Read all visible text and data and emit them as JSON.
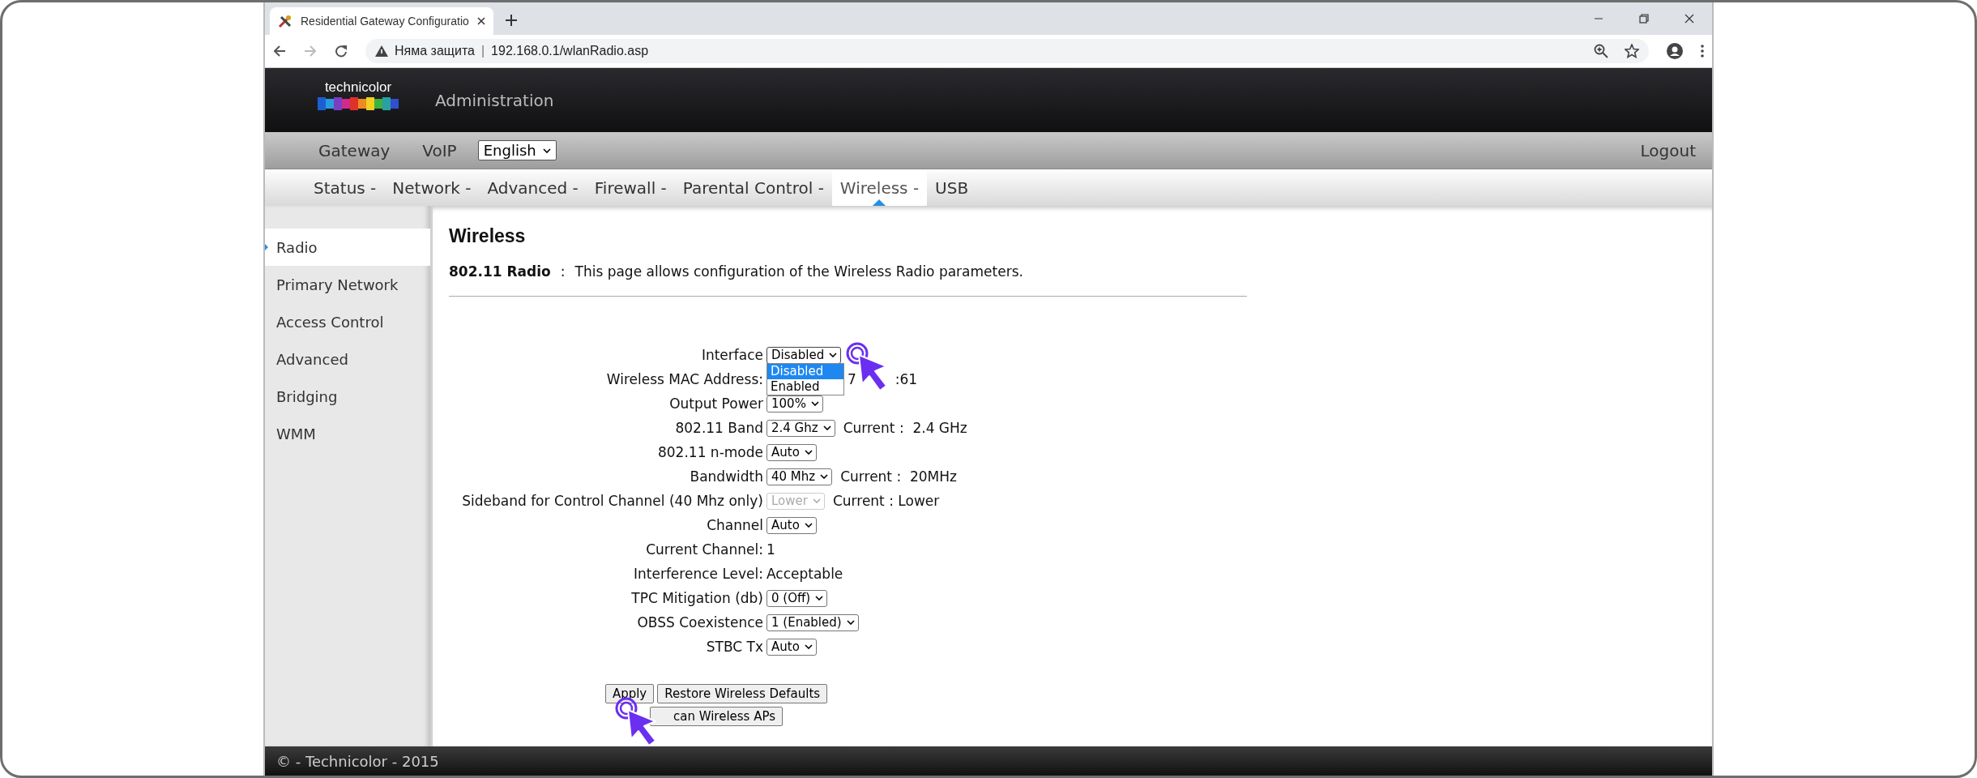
{
  "browser": {
    "tab_title": "Residential Gateway Configuratio",
    "address_warning": "Няма защита",
    "address_separator": "|",
    "url": "192.168.0.1/wlanRadio.asp"
  },
  "header": {
    "logo": "technicolor",
    "title": "Administration"
  },
  "top_nav": {
    "items": [
      {
        "label": "Gateway"
      },
      {
        "label": "VoIP"
      }
    ],
    "language": "English",
    "logout": "Logout"
  },
  "menu": [
    {
      "label": "Status -",
      "selected": false
    },
    {
      "label": "Network -",
      "selected": false
    },
    {
      "label": "Advanced -",
      "selected": false
    },
    {
      "label": "Firewall -",
      "selected": false
    },
    {
      "label": "Parental Control -",
      "selected": false
    },
    {
      "label": "Wireless -",
      "selected": true
    },
    {
      "label": "USB",
      "selected": false
    }
  ],
  "sidebar": [
    {
      "label": "Radio",
      "selected": true
    },
    {
      "label": "Primary Network",
      "selected": false
    },
    {
      "label": "Access Control",
      "selected": false
    },
    {
      "label": "Advanced",
      "selected": false
    },
    {
      "label": "Bridging",
      "selected": false
    },
    {
      "label": "WMM",
      "selected": false
    }
  ],
  "page": {
    "title": "Wireless",
    "section": "802.11 Radio",
    "separator": ":",
    "description": "This page allows configuration of the Wireless Radio parameters."
  },
  "form": [
    {
      "kind": "select",
      "label": "Interface",
      "value": "Disabled",
      "disabled": false,
      "open": true,
      "options": [
        {
          "label": "Disabled",
          "selected": true
        },
        {
          "label": "Enabled",
          "selected": false
        }
      ]
    },
    {
      "kind": "partial",
      "label": "Wireless MAC Address:",
      "parts": [
        "7",
        ":61"
      ]
    },
    {
      "kind": "select",
      "label": "Output Power",
      "value": "100%",
      "disabled": false,
      "open": false
    },
    {
      "kind": "select",
      "label": "802.11 Band",
      "value": "2.4 Ghz",
      "disabled": false,
      "open": false,
      "note": "Current :  2.4 GHz"
    },
    {
      "kind": "select",
      "label": "802.11 n-mode",
      "value": "Auto",
      "disabled": false,
      "open": false
    },
    {
      "kind": "select",
      "label": "Bandwidth",
      "value": "40 Mhz",
      "disabled": false,
      "open": false,
      "note": "Current :  20MHz"
    },
    {
      "kind": "select",
      "label": "Sideband for Control Channel (40 Mhz only)",
      "value": "Lower",
      "disabled": true,
      "open": false,
      "note": "Current : Lower"
    },
    {
      "kind": "select",
      "label": "Channel",
      "value": "Auto",
      "disabled": false,
      "open": false
    },
    {
      "kind": "text",
      "label": "Current Channel:",
      "value": "1"
    },
    {
      "kind": "text",
      "label": "Interference Level:",
      "value": "Acceptable"
    },
    {
      "kind": "select",
      "label": "TPC Mitigation (db)",
      "value": "0 (Off)",
      "disabled": false,
      "open": false
    },
    {
      "kind": "select",
      "label": "OBSS Coexistence",
      "value": "1 (Enabled)",
      "disabled": false,
      "open": false
    },
    {
      "kind": "select",
      "label": "STBC Tx",
      "value": "Auto",
      "disabled": false,
      "open": false
    }
  ],
  "buttons": [
    {
      "label": "Apply"
    },
    {
      "label": "Restore Wireless Defaults"
    },
    {
      "label": "can Wireless APs"
    }
  ],
  "footer": "© - Technicolor - 2015"
}
